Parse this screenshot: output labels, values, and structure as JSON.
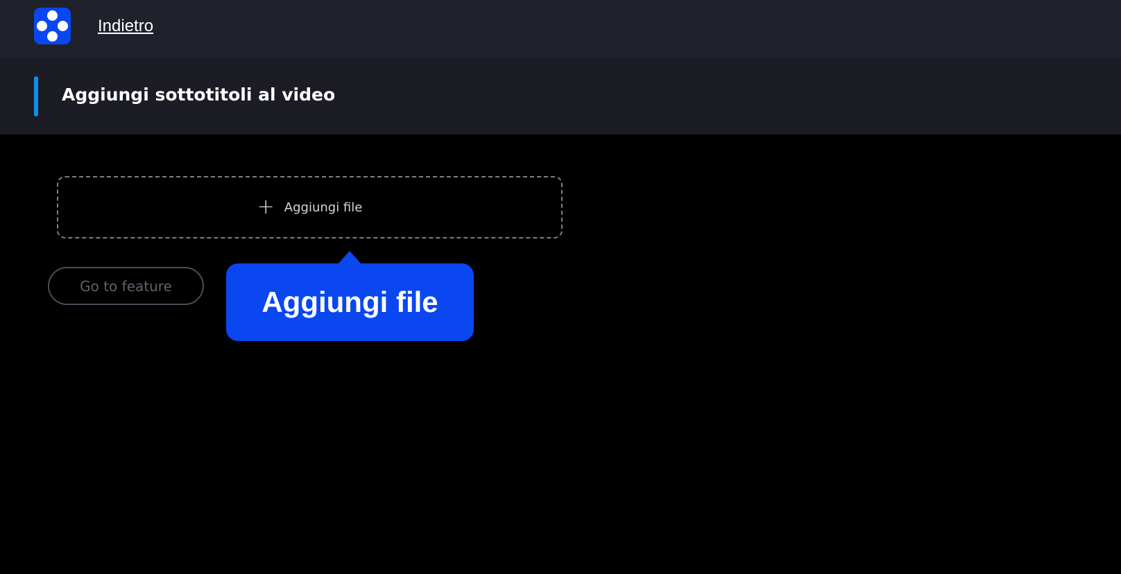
{
  "header": {
    "logo_icon": "app-logo-icon",
    "back_label": "Indietro",
    "brand_color": "#0a47f0"
  },
  "subheader": {
    "title": "Aggiungi sottotitoli al video",
    "accent_color": "#0e8ff0"
  },
  "main": {
    "dropzone": {
      "icon": "plus-icon",
      "plus": "+",
      "label": "Aggiungi file"
    },
    "go_to_feature_label": "Go to feature",
    "tooltip": {
      "text": "Aggiungi file"
    }
  }
}
